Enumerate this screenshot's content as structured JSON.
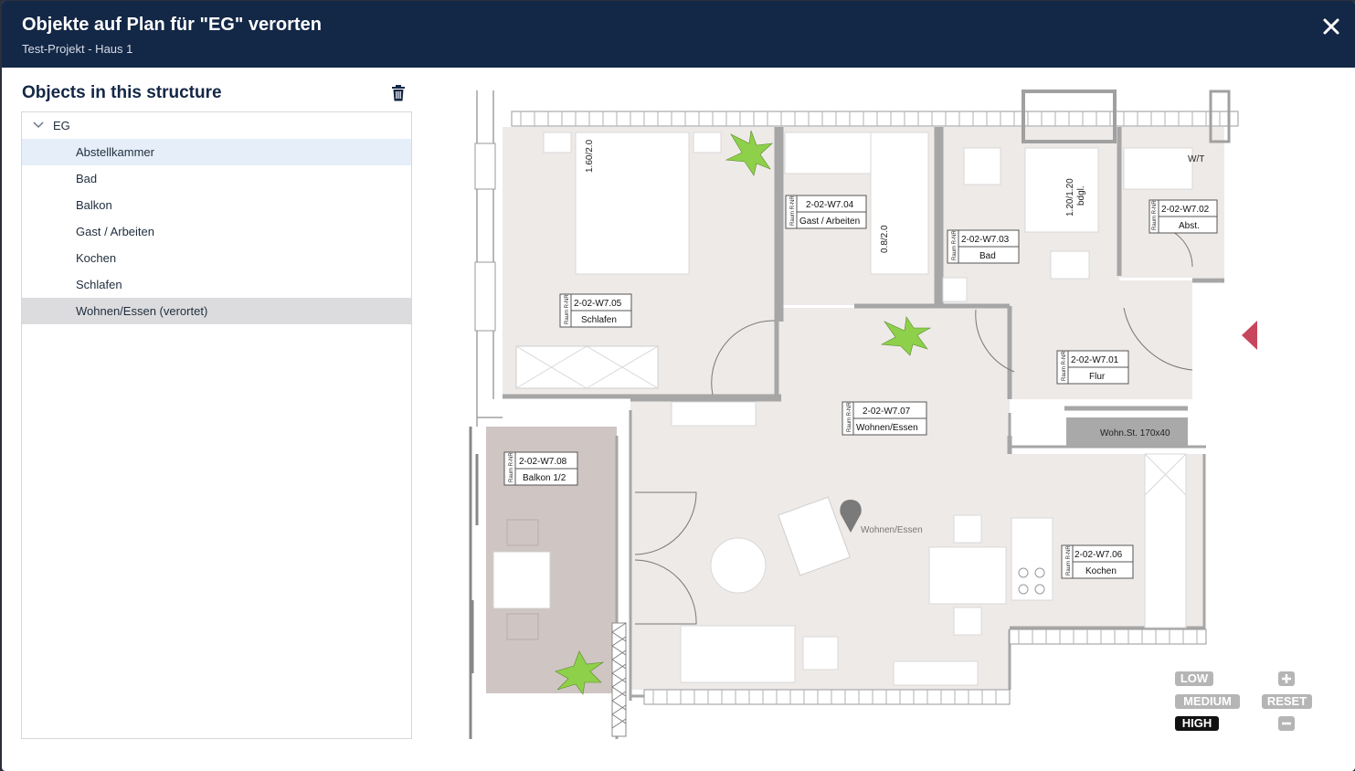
{
  "header": {
    "title": "Objekte auf Plan für \"EG\" verorten",
    "subtitle": "Test-Projekt - Haus 1"
  },
  "panel": {
    "title": "Objects in this structure",
    "root_label": "EG",
    "items": [
      {
        "label": "Abstellkammer",
        "state": "hover"
      },
      {
        "label": "Bad",
        "state": ""
      },
      {
        "label": "Balkon",
        "state": ""
      },
      {
        "label": "Gast / Arbeiten",
        "state": ""
      },
      {
        "label": "Kochen",
        "state": ""
      },
      {
        "label": "Schlafen",
        "state": ""
      },
      {
        "label": "Wohnen/Essen (verortet)",
        "state": "selected"
      }
    ]
  },
  "plan": {
    "rooms": [
      {
        "code": "2-02-W7.05",
        "name": "Schlafen"
      },
      {
        "code": "2-02-W7.04",
        "name": "Gast / Arbeiten"
      },
      {
        "code": "2-02-W7.03",
        "name": "Bad"
      },
      {
        "code": "2-02-W7.02",
        "name": "Abst."
      },
      {
        "code": "2-02-W7.01",
        "name": "Flur"
      },
      {
        "code": "2-02-W7.07",
        "name": "Wohnen/Essen"
      },
      {
        "code": "2-02-W7.08",
        "name": "Balkon 1/2"
      },
      {
        "code": "2-02-W7.06",
        "name": "Kochen"
      }
    ],
    "room_tag_side": "Raum R-NR",
    "dimension_labels": [
      "1.60/2.0",
      "0.8/2.0",
      "1.20/1.20",
      "bdgl.",
      "W/T"
    ],
    "furniture_label": "Wohn.St. 170x40",
    "pin_label": "Wohnen/Essen"
  },
  "zoom": {
    "quality": [
      "LOW",
      "MEDIUM",
      "HIGH"
    ],
    "active_quality": "HIGH",
    "reset_label": "RESET"
  },
  "colors": {
    "header_bg": "#132746",
    "selected_row": "#dcdcde",
    "hover_row": "#e5eef9",
    "marker": "#c8465b",
    "room_fill": "#eeeae8",
    "balcony_fill": "#cfc5c3",
    "plant": "#8ed04a"
  }
}
